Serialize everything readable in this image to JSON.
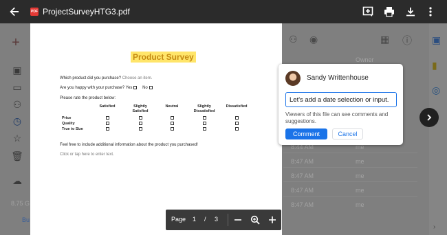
{
  "header": {
    "file_name": "ProjectSurveyHTG3.pdf",
    "pdf_badge": "PDF"
  },
  "background": {
    "column_header": "Owner",
    "rows": [
      {
        "time": "8:44 AM",
        "owner": "me"
      },
      {
        "time": "8:47 AM",
        "owner": "me"
      },
      {
        "time": "8:47 AM",
        "owner": "me"
      },
      {
        "time": "8:47 AM",
        "owner": "me"
      },
      {
        "time": "8:47 AM",
        "owner": "me"
      }
    ],
    "storage_text": "8.75 G",
    "buy_text": "Bu"
  },
  "document": {
    "title": "Product Survey",
    "q1_label": "Which product did you purchase?",
    "q1_placeholder": "Choose an item.",
    "q2_label": "Are you happy with your purchase?",
    "q2_yes": "Yes",
    "q2_no": "No",
    "rate_label": "Please rate the product below:",
    "grid_columns": [
      "Satisfied",
      "Slightly Satisfied",
      "Neutral",
      "Slightly Dissatisfied",
      "Dissatisfied"
    ],
    "grid_rows": [
      "Price",
      "Quality",
      "True to Size"
    ],
    "extra_label": "Feel free to include additional information about the product you purchased!",
    "extra_placeholder": "Click or tap here to enter text."
  },
  "pagebar": {
    "page_label": "Page",
    "current_page": "1",
    "separator": "/",
    "total_pages": "3"
  },
  "comment": {
    "user_name": "Sandy Writtenhouse",
    "input_value": "Let's add a date selection or input.",
    "notice": "Viewers of this file can see comments and suggestions.",
    "comment_button": "Comment",
    "cancel_button": "Cancel"
  },
  "colors": {
    "accent": "#1a73e8",
    "title_highlight": "#ffe56a"
  }
}
